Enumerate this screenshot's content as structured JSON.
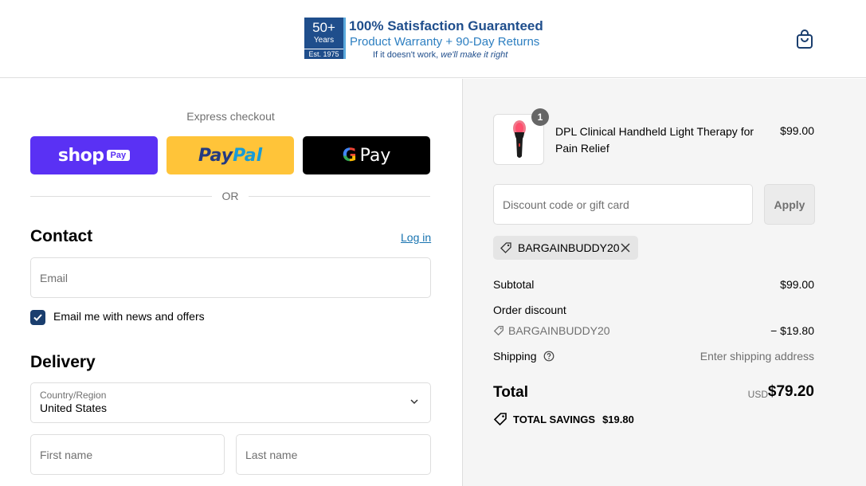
{
  "header": {
    "logo": {
      "badge_big": "50+",
      "badge_mid": "Years",
      "badge_small": "Est. 1975",
      "line1": "100% Satisfaction Guaranteed",
      "line2": "Product Warranty + 90-Day Returns",
      "line3_plain": "If it doesn't work, ",
      "line3_italic": "we'll make it right"
    },
    "cart_icon": "shopping-bag-icon"
  },
  "express": {
    "label": "Express checkout",
    "shop_word": "shop",
    "shop_pay": "Pay",
    "paypal_1": "Pay",
    "paypal_2": "Pal",
    "gpay_g": "G",
    "gpay_word": "Pay",
    "divider_text": "OR"
  },
  "contact": {
    "title": "Contact",
    "login": "Log in",
    "email_placeholder": "Email",
    "newsletter_label": "Email me with news and offers",
    "newsletter_checked": true
  },
  "delivery": {
    "title": "Delivery",
    "country_label": "Country/Region",
    "country_value": "United States",
    "first_name_placeholder": "First name",
    "last_name_placeholder": "Last name"
  },
  "summary": {
    "product": {
      "name": "DPL Clinical Handheld Light Therapy for Pain Relief",
      "price": "$99.00",
      "quantity": "1"
    },
    "discount_placeholder": "Discount code or gift card",
    "apply_label": "Apply",
    "applied_code": "BARGAINBUDDY20",
    "subtotal_label": "Subtotal",
    "subtotal_value": "$99.00",
    "order_discount_label": "Order discount",
    "discount_code": "BARGAINBUDDY20",
    "discount_value": "− $19.80",
    "shipping_label": "Shipping",
    "shipping_value": "Enter shipping address",
    "total_label": "Total",
    "currency": "USD",
    "total_value": "$79.20",
    "savings_label": "TOTAL SAVINGS",
    "savings_value": "$19.80"
  },
  "colors": {
    "shop_pay": "#5a31f4",
    "paypal": "#ffc439",
    "accent_link": "#1773b0",
    "checkbox": "#1a3e6e"
  }
}
